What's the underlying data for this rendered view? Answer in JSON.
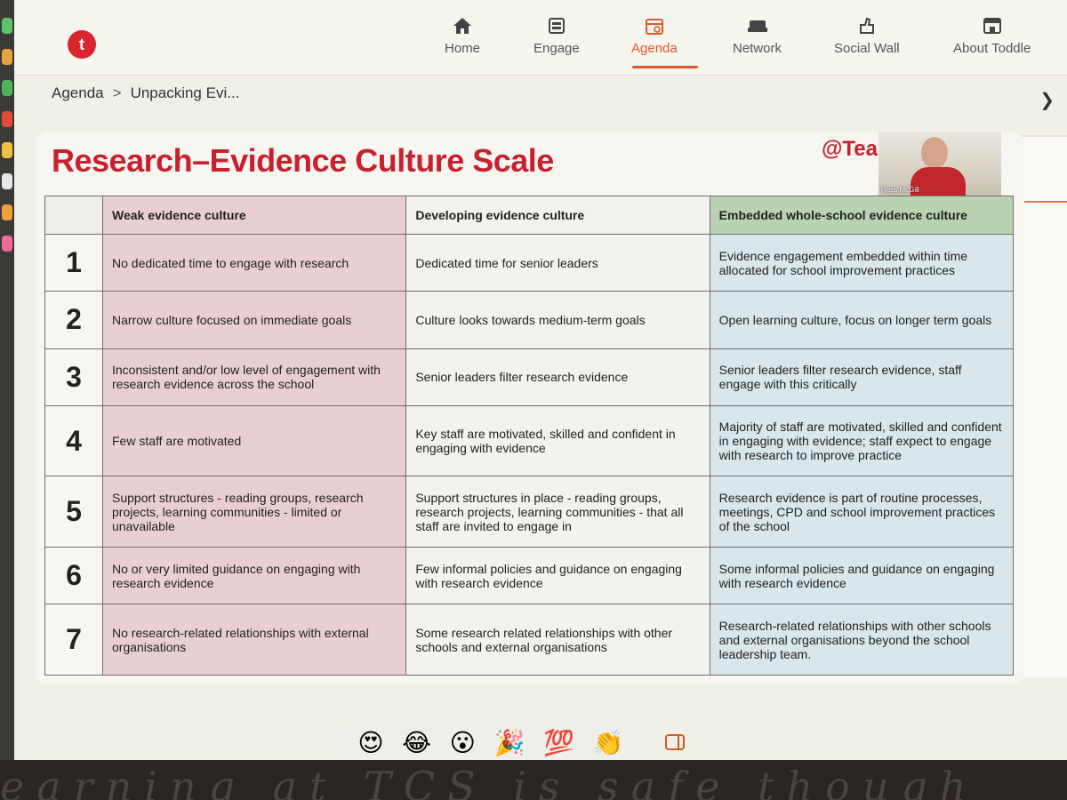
{
  "app": {
    "logo_letter": "t",
    "brand_color": "#d9232e",
    "accent_color": "#e05a2b"
  },
  "nav": [
    {
      "label": "Home",
      "icon": "home-icon"
    },
    {
      "label": "Engage",
      "icon": "engage-icon"
    },
    {
      "label": "Agenda",
      "icon": "agenda-icon",
      "active": true
    },
    {
      "label": "Network",
      "icon": "network-icon"
    },
    {
      "label": "Social Wall",
      "icon": "social-wall-icon"
    },
    {
      "label": "About Toddle",
      "icon": "about-icon"
    }
  ],
  "breadcrumb": {
    "root": "Agenda",
    "separator": ">",
    "current": "Unpacking Evi..."
  },
  "slide": {
    "title": "Research–Evidence Culture Scale",
    "handle": "@Tea",
    "presenter_name": "Ross McGill",
    "table": {
      "headers": [
        "",
        "Weak evidence culture",
        "Developing evidence culture",
        "Embedded whole-school evidence culture"
      ],
      "rows": [
        {
          "num": "1",
          "weak": "No dedicated time to engage with research",
          "dev": "Dedicated time for senior leaders",
          "emb": "Evidence engagement embedded within time allocated for school improvement practices"
        },
        {
          "num": "2",
          "weak": "Narrow culture focused on immediate goals",
          "dev": "Culture looks towards medium-term goals",
          "emb": "Open learning culture, focus on longer term goals"
        },
        {
          "num": "3",
          "weak": "Inconsistent and/or low level of engagement with research evidence across the school",
          "dev": "Senior leaders filter research evidence",
          "emb": "Senior leaders filter research evidence, staff engage with this critically"
        },
        {
          "num": "4",
          "weak": "Few staff are motivated",
          "dev": "Key staff are motivated, skilled and confident in engaging with evidence",
          "emb": "Majority of staff are motivated, skilled and confident in engaging with evidence; staff expect to engage with research to improve practice"
        },
        {
          "num": "5",
          "weak": "Support structures - reading groups, research projects, learning communities - limited or unavailable",
          "dev": "Support structures in place - reading groups, research projects, learning communities - that all staff are invited to engage in",
          "emb": "Research evidence is part of routine processes, meetings, CPD and school improvement practices of the school"
        },
        {
          "num": "6",
          "weak": "No or very limited guidance on engaging with research evidence",
          "dev": "Few informal policies and guidance on engaging with research evidence",
          "emb": "Some informal policies and guidance on engaging with research evidence"
        },
        {
          "num": "7",
          "weak": "No research-related relationships with external organisations",
          "dev": "Some research related relationships with other schools and external organisations",
          "emb": "Research-related relationships with other schools and external organisations beyond the school leadership team."
        }
      ]
    }
  },
  "reactions": [
    {
      "emoji": "😍",
      "icon": "heart-eyes-icon"
    },
    {
      "emoji": "😂",
      "icon": "laughing-icon"
    },
    {
      "emoji": "😮",
      "icon": "surprised-icon"
    },
    {
      "emoji": "🎉",
      "icon": "party-popper-icon"
    },
    {
      "emoji": "💯",
      "icon": "hundred-icon"
    },
    {
      "emoji": "👏",
      "icon": "clapping-icon"
    }
  ],
  "desk_text": "earning at TCS is safe though"
}
